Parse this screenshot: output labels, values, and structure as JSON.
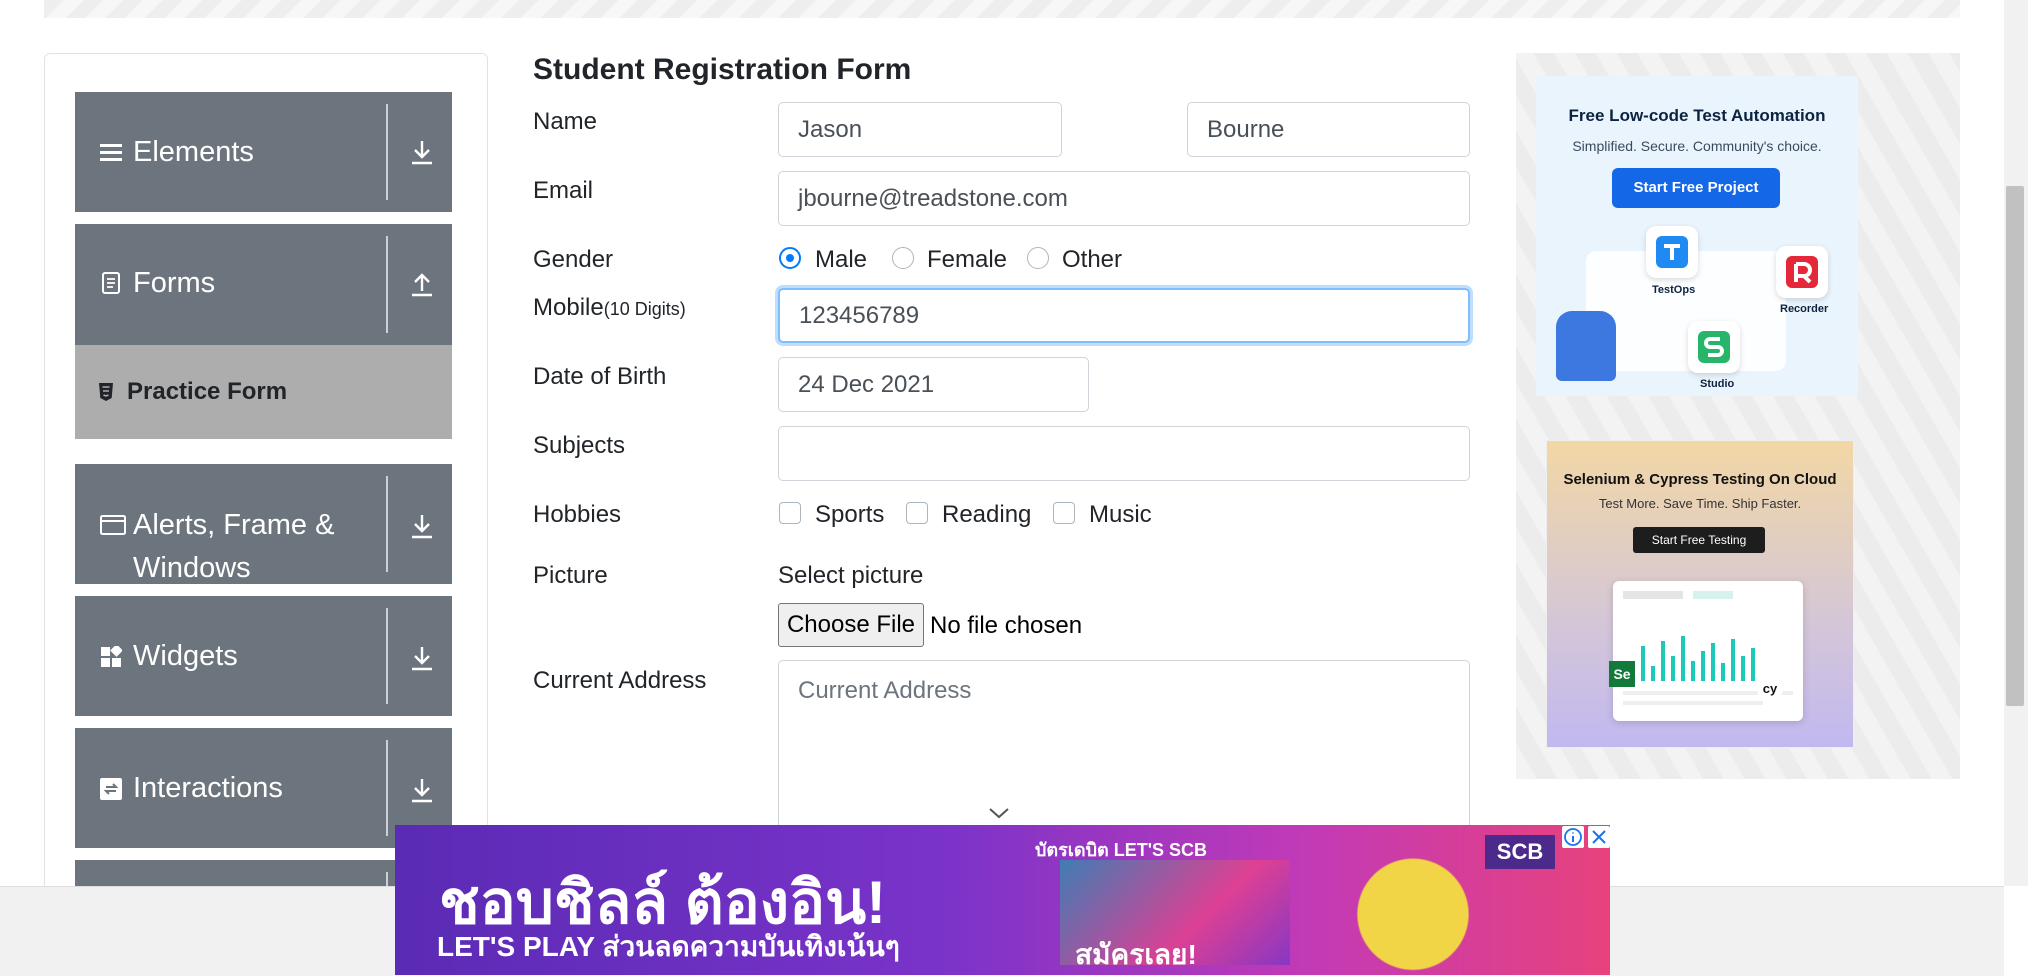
{
  "nav": {
    "groups": [
      {
        "label": "Elements",
        "icon": "menu-icon",
        "arrow": "download-arrow-icon"
      },
      {
        "label": "Forms",
        "icon": "document-icon",
        "arrow": "upload-arrow-icon"
      },
      {
        "label": "Alerts, Frame & Windows",
        "icon": "window-icon",
        "arrow": "download-arrow-icon"
      },
      {
        "label": "Widgets",
        "icon": "widgets-icon",
        "arrow": "download-arrow-icon"
      },
      {
        "label": "Interactions",
        "icon": "interactions-icon",
        "arrow": "download-arrow-icon"
      }
    ],
    "active_item": {
      "label": "Practice Form",
      "icon": "html5-icon"
    },
    "alerts_line1": "Alerts, Frame &",
    "alerts_line2": "Windows"
  },
  "form": {
    "title": "Student Registration Form",
    "name_label": "Name",
    "first_name": "Jason",
    "last_name": "Bourne",
    "email_label": "Email",
    "email": "jbourne@treadstone.com",
    "gender_label": "Gender",
    "gender_options": [
      "Male",
      "Female",
      "Other"
    ],
    "gender_selected": "Male",
    "mobile_label": "Mobile",
    "mobile_hint": "(10 Digits)",
    "mobile": "123456789",
    "dob_label": "Date of Birth",
    "dob": "24 Dec 2021",
    "subjects_label": "Subjects",
    "subjects": "",
    "hobbies_label": "Hobbies",
    "hobbies": [
      "Sports",
      "Reading",
      "Music"
    ],
    "picture_label": "Picture",
    "select_picture": "Select picture",
    "choose_file": "Choose File",
    "no_file": "No file chosen",
    "address_label": "Current Address",
    "address_placeholder": "Current Address"
  },
  "ads": {
    "ad1": {
      "title": "Free Low-code Test Automation",
      "subtitle": "Simplified. Secure. Community's choice.",
      "button": "Start Free Project",
      "tiles": [
        "TestOps",
        "Recorder",
        "Studio"
      ]
    },
    "ad2": {
      "title": "Selenium & Cypress Testing On Cloud",
      "subtitle": "Test More. Save Time. Ship Faster.",
      "button": "Start Free Testing"
    },
    "banner": {
      "top_text": "บัตรเดบิต LET'S SCB",
      "main_text": "ชอบชิลล์ ต้องอิน!",
      "small_text": "LET'S PLAY ส่วนลดความบันเทิงเน้นๆ",
      "cta": "สมัครเลย!",
      "brand": "SCB"
    }
  },
  "colors": {
    "nav_bg": "#6c757d",
    "nav_active_bg": "#adadad",
    "accent": "#007bff",
    "focus_border": "#80bdff"
  }
}
